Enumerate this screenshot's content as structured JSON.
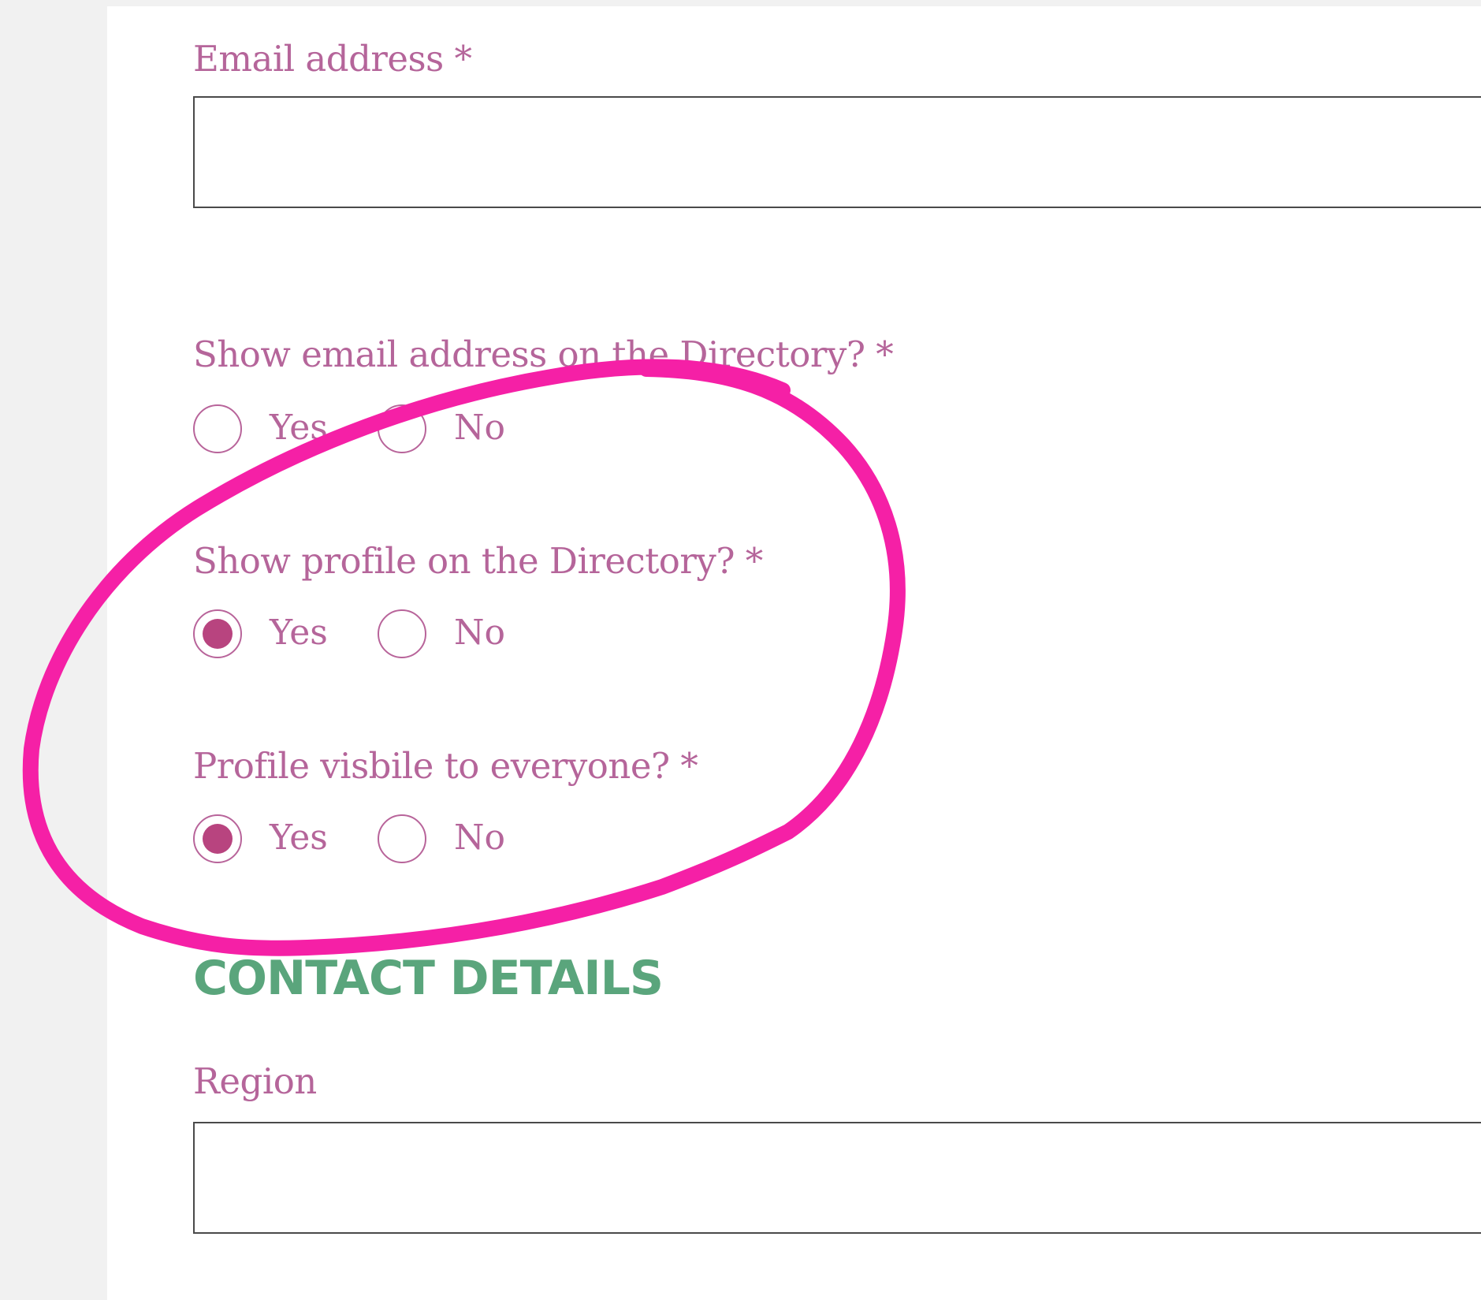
{
  "form": {
    "email": {
      "label": "Email address *",
      "value": "",
      "placeholder": ""
    },
    "show_email": {
      "label": "Show email address on the Directory? *",
      "options": [
        {
          "label": "Yes",
          "checked": false
        },
        {
          "label": "No",
          "checked": false
        }
      ]
    },
    "show_profile": {
      "label": "Show profile on the Directory? *",
      "options": [
        {
          "label": "Yes",
          "checked": true
        },
        {
          "label": "No",
          "checked": false
        }
      ]
    },
    "profile_visible": {
      "label": "Profile visbile to everyone? *",
      "options": [
        {
          "label": "Yes",
          "checked": true
        },
        {
          "label": "No",
          "checked": false
        }
      ]
    },
    "contact_section": {
      "heading": "CONTACT DETAILS"
    },
    "region": {
      "label": "Region",
      "value": "",
      "placeholder": ""
    }
  },
  "colors": {
    "label_text": "#b5659a",
    "radio_border": "#b8649a",
    "radio_fill": "#b8447f",
    "section_heading": "#5aa57c",
    "annotation_stroke": "#f520a6",
    "page_background": "#f1f1f1",
    "panel_background": "#ffffff",
    "input_border": "#4a4a4a"
  },
  "annotation": {
    "type": "hand-drawn-ellipse",
    "encloses": [
      "show_email",
      "show_profile",
      "profile_visible"
    ]
  }
}
